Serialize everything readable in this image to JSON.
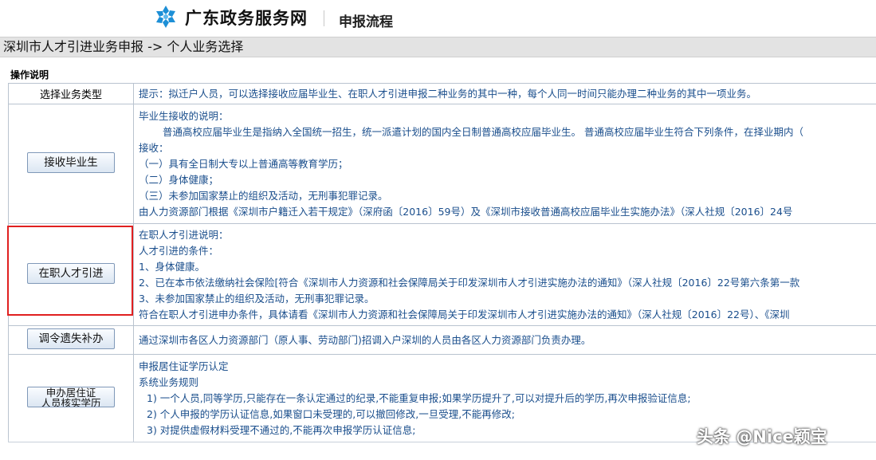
{
  "header": {
    "logo_text": "广东政务服务网",
    "section_title": "申报流程"
  },
  "breadcrumb": "深圳市人才引进业务申报 -> 个人业务选择",
  "ops_label": "操作说明",
  "table": {
    "header": {
      "left": "选择业务类型",
      "right": "提示：拟迁户人员，可以选择接收应届毕业生、在职人才引进申报二种业务的其中一种，每个人同一时间只能办理二种业务的其中一项业务。"
    },
    "rows": [
      {
        "button": "接收毕业生",
        "lines": [
          "毕业生接收的说明：",
          "普通高校应届毕业生是指纳入全国统一招生，统一派遣计划的国内全日制普通高校应届毕业生。 普通高校应届毕业生符合下列条件，在择业期内（",
          "接收：",
          "（一）具有全日制大专以上普通高等教育学历；",
          "（二）身体健康；",
          "（三）未参加国家禁止的组织及活动，无刑事犯罪记录。",
          "由人力资源部门根据《深圳市户籍迁入若干规定》（深府函〔2016〕59号）及《深圳市接收普通高校应届毕业生实施办法》（深人社规〔2016〕24号"
        ]
      },
      {
        "button": "在职人才引进",
        "lines": [
          "在职人才引进说明：",
          "人才引进的条件：",
          "1、身体健康。",
          "2、已在本市依法缴纳社会保险[符合《深圳市人力资源和社会保障局关于印发深圳市人才引进实施办法的通知》（深人社规〔2016〕22号第六条第一款",
          "3、未参加国家禁止的组织及活动，无刑事犯罪记录。",
          "符合在职人才引进申办条件，具体请看《深圳市人力资源和社会保障局关于印发深圳市人才引进实施办法的通知》（深人社规〔2016〕22号）、《深圳"
        ]
      },
      {
        "button": "调令遗失补办",
        "lines": [
          "通过深圳市各区人力资源部门（原人事、劳动部门)招调入户深圳的人员由各区人力资源部门负责办理。"
        ]
      },
      {
        "button_line1": "申办居住证",
        "button_line2": "人员核实学历",
        "lines": [
          "申报居住证学历认定",
          "系统业务规则",
          "1) 一个人员,同等学历,只能存在一条认定通过的纪录,不能重复申报;如果学历提升了,可以对提升后的学历,再次申报验证信息;",
          "2) 个人申报的学历认证信息,如果窗口未受理的,可以撤回修改,一旦受理,不能再修改;",
          "3) 对提供虚假材料受理不通过的,不能再次申报学历认证信息;"
        ]
      }
    ]
  },
  "watermark": "头条 @Nice颖宝",
  "colors": {
    "link_text": "#1a4e8c",
    "breadcrumb_bg": "#e3e3e3",
    "highlight": "#e02020",
    "logo_blue": "#1d8fd6"
  }
}
